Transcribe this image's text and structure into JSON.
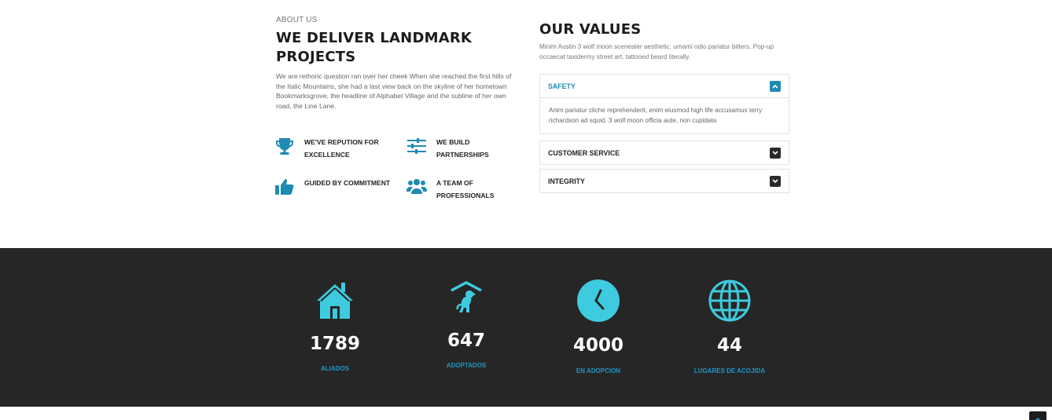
{
  "about": {
    "eyebrow": "ABOUT US",
    "heading": "WE DELIVER LANDMARK PROJECTS",
    "body": "We are rethoric question ran over her cheek When she reached the first hills of the Italic Mountains, she had a last view back on the skyline of her hometown Bookmarksgrove, the headline of Alphabet Village and the subline of her own road, the Line Lane."
  },
  "features": [
    {
      "icon": "trophy-icon",
      "label": "WE'VE REPUTION FOR EXCELLENCE"
    },
    {
      "icon": "sliders-icon",
      "label": "WE BUILD PARTNERSHIPS"
    },
    {
      "icon": "thumbs-up-icon",
      "label": "GUIDED BY COMMITMENT"
    },
    {
      "icon": "users-icon",
      "label": "A TEAM OF PROFESSIONALS"
    }
  ],
  "values": {
    "heading": "OUR VALUES",
    "description": "Minim Austin 3 wolf moon scenester aesthetic, umami odio pariatur bitters. Pop-up occaecat taxidermy street art, tattooed beard literally.",
    "items": [
      {
        "title": "SAFETY",
        "expanded": true,
        "body": "Anim pariatur cliche reprehenderit, enim eiusmod high life accusamus terry richardson ad squid. 3 wolf moon officia aute, non cupidata"
      },
      {
        "title": "CUSTOMER SERVICE",
        "expanded": false
      },
      {
        "title": "INTEGRITY",
        "expanded": false
      }
    ]
  },
  "stats": [
    {
      "icon": "house-icon",
      "number": "1789",
      "label": "ALIADOS"
    },
    {
      "icon": "dog-shelter-icon",
      "number": "647",
      "label": "ADOPTADOS"
    },
    {
      "icon": "clock-icon",
      "number": "4000",
      "label": "EN ADOPCION"
    },
    {
      "icon": "globe-icon",
      "number": "44",
      "label": "LUGARES DE ACOJIDA"
    }
  ],
  "colors": {
    "accent": "#1d8bb3",
    "icon_cyan": "#3ecbe0",
    "stat_label": "#2196c4",
    "dark_band": "#262626"
  }
}
